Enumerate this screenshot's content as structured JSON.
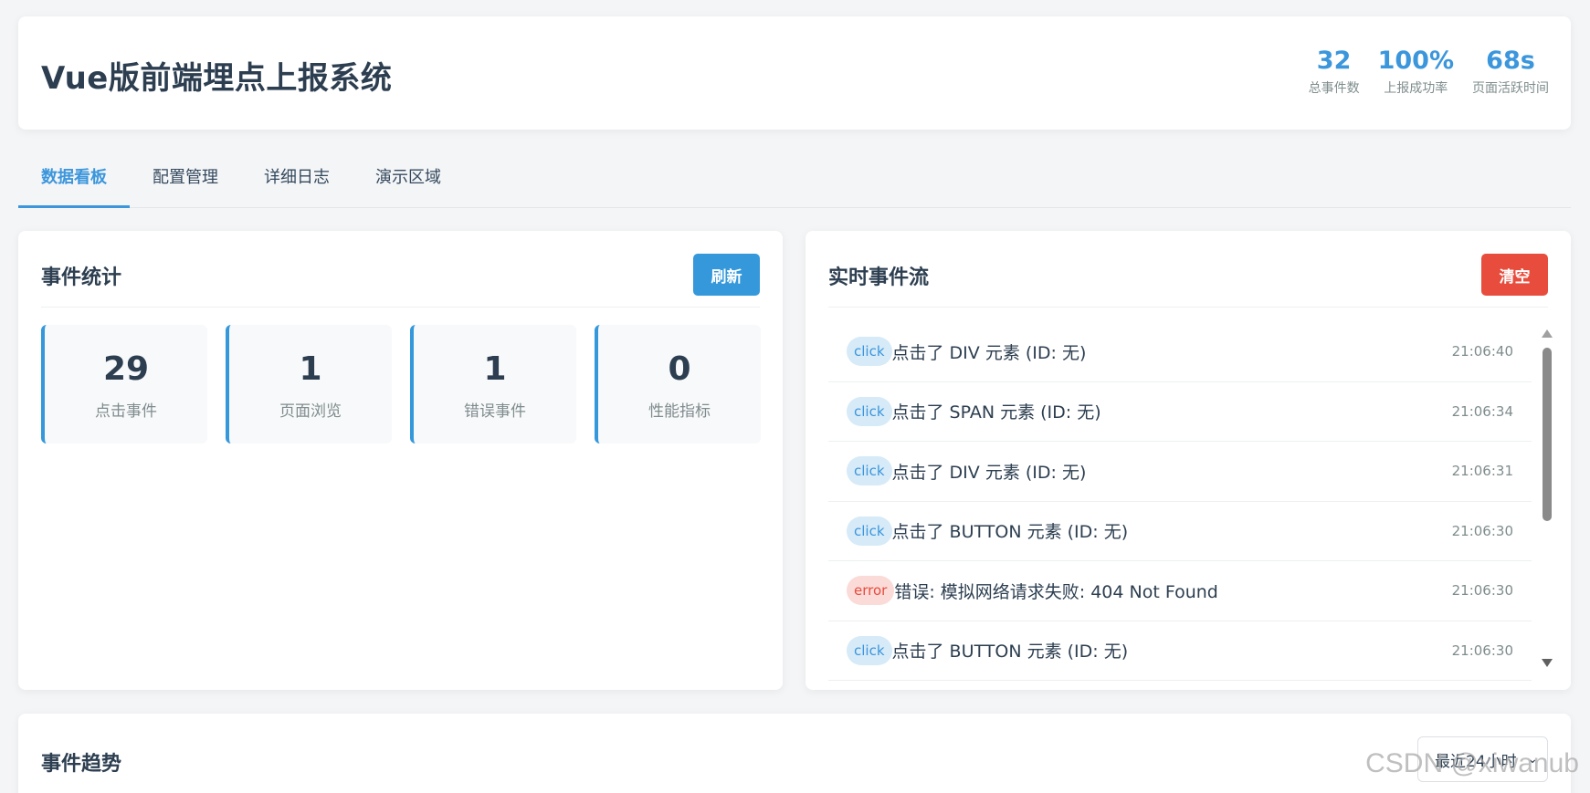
{
  "header": {
    "title": "Vue版前端埋点上报系统",
    "stats": [
      {
        "value": "32",
        "label": "总事件数"
      },
      {
        "value": "100%",
        "label": "上报成功率"
      },
      {
        "value": "68s",
        "label": "页面活跃时间"
      }
    ]
  },
  "tabs": [
    {
      "label": "数据看板",
      "active": true
    },
    {
      "label": "配置管理",
      "active": false
    },
    {
      "label": "详细日志",
      "active": false
    },
    {
      "label": "演示区域",
      "active": false
    }
  ],
  "event_stats": {
    "title": "事件统计",
    "refresh_label": "刷新",
    "cards": [
      {
        "value": "29",
        "label": "点击事件"
      },
      {
        "value": "1",
        "label": "页面浏览"
      },
      {
        "value": "1",
        "label": "错误事件"
      },
      {
        "value": "0",
        "label": "性能指标"
      }
    ]
  },
  "event_stream": {
    "title": "实时事件流",
    "clear_label": "清空",
    "events": [
      {
        "type": "click",
        "message": "点击了 DIV 元素 (ID: 无)",
        "time": "21:06:40"
      },
      {
        "type": "click",
        "message": "点击了 SPAN 元素 (ID: 无)",
        "time": "21:06:34"
      },
      {
        "type": "click",
        "message": "点击了 DIV 元素 (ID: 无)",
        "time": "21:06:31"
      },
      {
        "type": "click",
        "message": "点击了 BUTTON 元素 (ID: 无)",
        "time": "21:06:30"
      },
      {
        "type": "error",
        "message": "错误: 模拟网络请求失败: 404 Not Found",
        "time": "21:06:30"
      },
      {
        "type": "click",
        "message": "点击了 BUTTON 元素 (ID: 无)",
        "time": "21:06:30"
      }
    ]
  },
  "trend": {
    "title": "事件趋势",
    "range_selected": "最近24小时"
  },
  "watermark": "CSDN @xiwanub",
  "colors": {
    "accent": "#3498db",
    "danger": "#e74c3c",
    "text": "#2c3e50",
    "muted": "#7f8c8d"
  }
}
